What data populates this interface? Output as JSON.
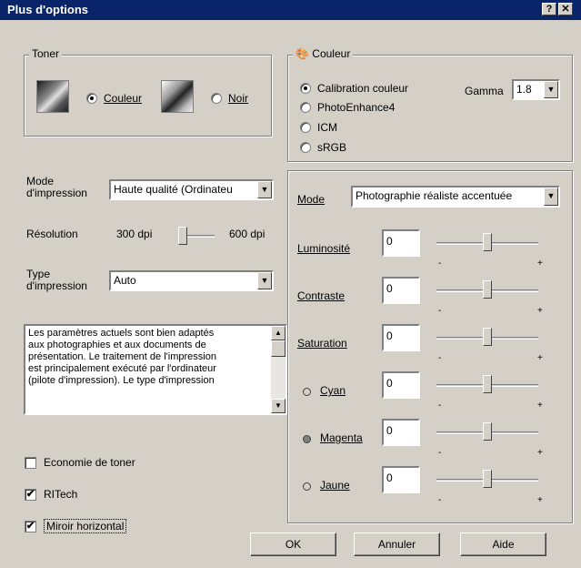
{
  "title": "Plus d'options",
  "title_buttons": {
    "help": "?",
    "close": "✕"
  },
  "toner": {
    "legend": "Toner",
    "color_label": "Couleur",
    "mono_label": "Noir",
    "selected": "Couleur"
  },
  "couleur": {
    "legend": "Couleur",
    "options": [
      "Calibration couleur",
      "PhotoEnhance4",
      "ICM",
      "sRGB"
    ],
    "selected": "Calibration couleur",
    "gamma_label": "Gamma",
    "gamma_value": "1.8"
  },
  "mode_impression": {
    "label_line1": "Mode",
    "label_line2": "d'impression",
    "value": "Haute qualité (Ordinateu"
  },
  "resolution": {
    "label": "Résolution",
    "min": "300 dpi",
    "max": "600 dpi"
  },
  "type_impression": {
    "label_line1": "Type",
    "label_line2": "d'impression",
    "value": "Auto"
  },
  "description": "Les paramètres actuels sont bien adaptés\naux photographies et aux documents de\nprésentation. Le traitement de l'impression\nest principalement exécuté par l'ordinateur\n(pilote d'impression). Le type d'impression",
  "checkboxes": {
    "economie": {
      "label": "Economie de toner",
      "checked": false
    },
    "ritech": {
      "label": "RITech",
      "checked": true
    },
    "miroir": {
      "label": "Miroir horizontal",
      "checked": true
    }
  },
  "adjust": {
    "mode_label": "Mode",
    "mode_value": "Photographie réaliste accentuée",
    "rows": [
      {
        "label": "Luminosité",
        "value": "0"
      },
      {
        "label": "Contraste",
        "value": "0"
      },
      {
        "label": "Saturation",
        "value": "0"
      },
      {
        "label": "Cyan",
        "value": "0",
        "dot": "#d4d0c8"
      },
      {
        "label": "Magenta",
        "value": "0",
        "dot": "#808080"
      },
      {
        "label": "Jaune",
        "value": "0",
        "dot": "#d4d0c8"
      }
    ],
    "minus": "-",
    "plus": "+"
  },
  "buttons": {
    "ok": "OK",
    "cancel": "Annuler",
    "help": "Aide"
  },
  "icons": {
    "check": "✔",
    "dropdown": "▼",
    "up": "▲",
    "down": "▼"
  }
}
